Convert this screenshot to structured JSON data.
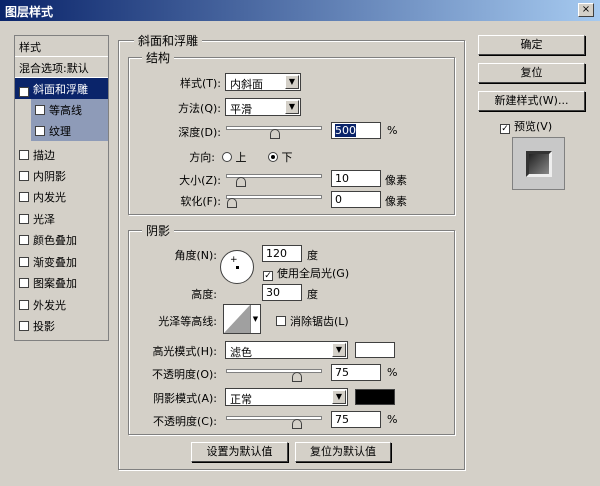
{
  "window": {
    "title": "图层样式",
    "close": "×"
  },
  "sidebar": {
    "header": "样式",
    "blend": "混合选项:默认",
    "items": [
      {
        "label": "斜面和浮雕",
        "checked": true
      },
      {
        "label": "等高线",
        "checked": false
      },
      {
        "label": "纹理",
        "checked": false
      },
      {
        "label": "描边",
        "checked": false
      },
      {
        "label": "内阴影",
        "checked": false
      },
      {
        "label": "内发光",
        "checked": false
      },
      {
        "label": "光泽",
        "checked": false
      },
      {
        "label": "颜色叠加",
        "checked": false
      },
      {
        "label": "渐变叠加",
        "checked": false
      },
      {
        "label": "图案叠加",
        "checked": false
      },
      {
        "label": "外发光",
        "checked": false
      },
      {
        "label": "投影",
        "checked": false
      }
    ]
  },
  "main": {
    "title": "斜面和浮雕",
    "structure": {
      "title": "结构",
      "style_label": "样式(T):",
      "style_value": "内斜面",
      "technique_label": "方法(Q):",
      "technique_value": "平滑",
      "depth_label": "深度(D):",
      "depth_value": "500",
      "depth_unit": "%",
      "depth_fraction": 0.5,
      "direction_label": "方向:",
      "dir_up": "上",
      "dir_down": "下",
      "direction": "down",
      "size_label": "大小(Z):",
      "size_value": "10",
      "size_unit": "像素",
      "size_fraction": 0.1,
      "soften_label": "软化(F):",
      "soften_value": "0",
      "soften_unit": "像素",
      "soften_fraction": 0
    },
    "shading": {
      "title": "阴影",
      "angle_label": "角度(N):",
      "angle_value": "120",
      "angle_unit": "度",
      "global_light": "使用全局光(G)",
      "global_light_checked": true,
      "altitude_label": "高度:",
      "altitude_value": "30",
      "altitude_unit": "度",
      "gloss_label": "光泽等高线:",
      "antialias": "消除锯齿(L)",
      "antialias_checked": false,
      "highlight_label": "高光模式(H):",
      "highlight_mode": "滤色",
      "highlight_color": "#ffffff",
      "hl_opacity_label": "不透明度(O):",
      "hl_opacity": "75",
      "hl_unit": "%",
      "hl_fraction": 0.75,
      "shadow_label": "阴影模式(A):",
      "shadow_mode": "正常",
      "shadow_color": "#000000",
      "sh_opacity_label": "不透明度(C):",
      "sh_opacity": "75",
      "sh_unit": "%",
      "sh_fraction": 0.75
    },
    "make_default": "设置为默认值",
    "reset_default": "复位为默认值"
  },
  "right": {
    "ok": "确定",
    "reset": "复位",
    "new_style": "新建样式(W)...",
    "preview": "预览(V)",
    "preview_checked": true
  }
}
